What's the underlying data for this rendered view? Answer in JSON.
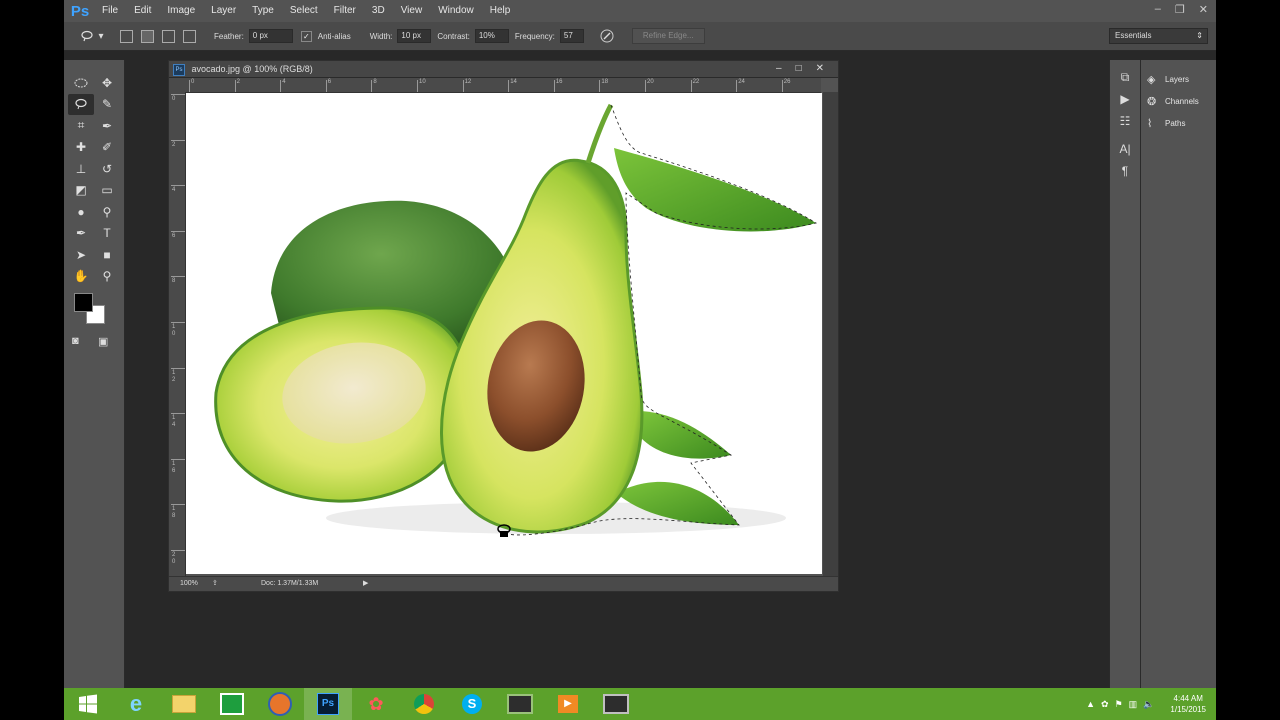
{
  "menubar": {
    "logo": "Ps",
    "items": [
      "File",
      "Edit",
      "Image",
      "Layer",
      "Type",
      "Select",
      "Filter",
      "3D",
      "View",
      "Window",
      "Help"
    ],
    "window_controls": [
      "–",
      "❐",
      "✕"
    ]
  },
  "options": {
    "feather_label": "Feather:",
    "feather_value": "0 px",
    "antialias_label": "Anti-alias",
    "width_label": "Width:",
    "width_value": "10 px",
    "contrast_label": "Contrast:",
    "contrast_value": "10%",
    "frequency_label": "Frequency:",
    "frequency_value": "57",
    "refine_edge": "Refine Edge...",
    "workspace": "Essentials"
  },
  "document": {
    "title": "avocado.jpg @ 100% (RGB/8)",
    "ps_icon": "Ps",
    "zoom": "100%",
    "doc_size": "Doc: 1.37M/1.33M",
    "ruler_top": [
      "0",
      "2",
      "4",
      "6",
      "8",
      "10",
      "12",
      "14",
      "16",
      "18",
      "20",
      "22",
      "24",
      "26"
    ],
    "ruler_left": [
      "0",
      "2",
      "4",
      "6",
      "8",
      "10",
      "12",
      "14",
      "16",
      "18",
      "20"
    ]
  },
  "panels": {
    "items": [
      {
        "label": "Layers",
        "icon": "layers-icon"
      },
      {
        "label": "Channels",
        "icon": "channels-icon"
      },
      {
        "label": "Paths",
        "icon": "paths-icon"
      }
    ]
  },
  "taskbar": {
    "time": "4:44 AM",
    "date": "1/15/2015"
  },
  "colors": {
    "taskbar": "#5ca12b",
    "app_bg": "#282828",
    "panel": "#535353",
    "accent": "#3fa3ff"
  }
}
